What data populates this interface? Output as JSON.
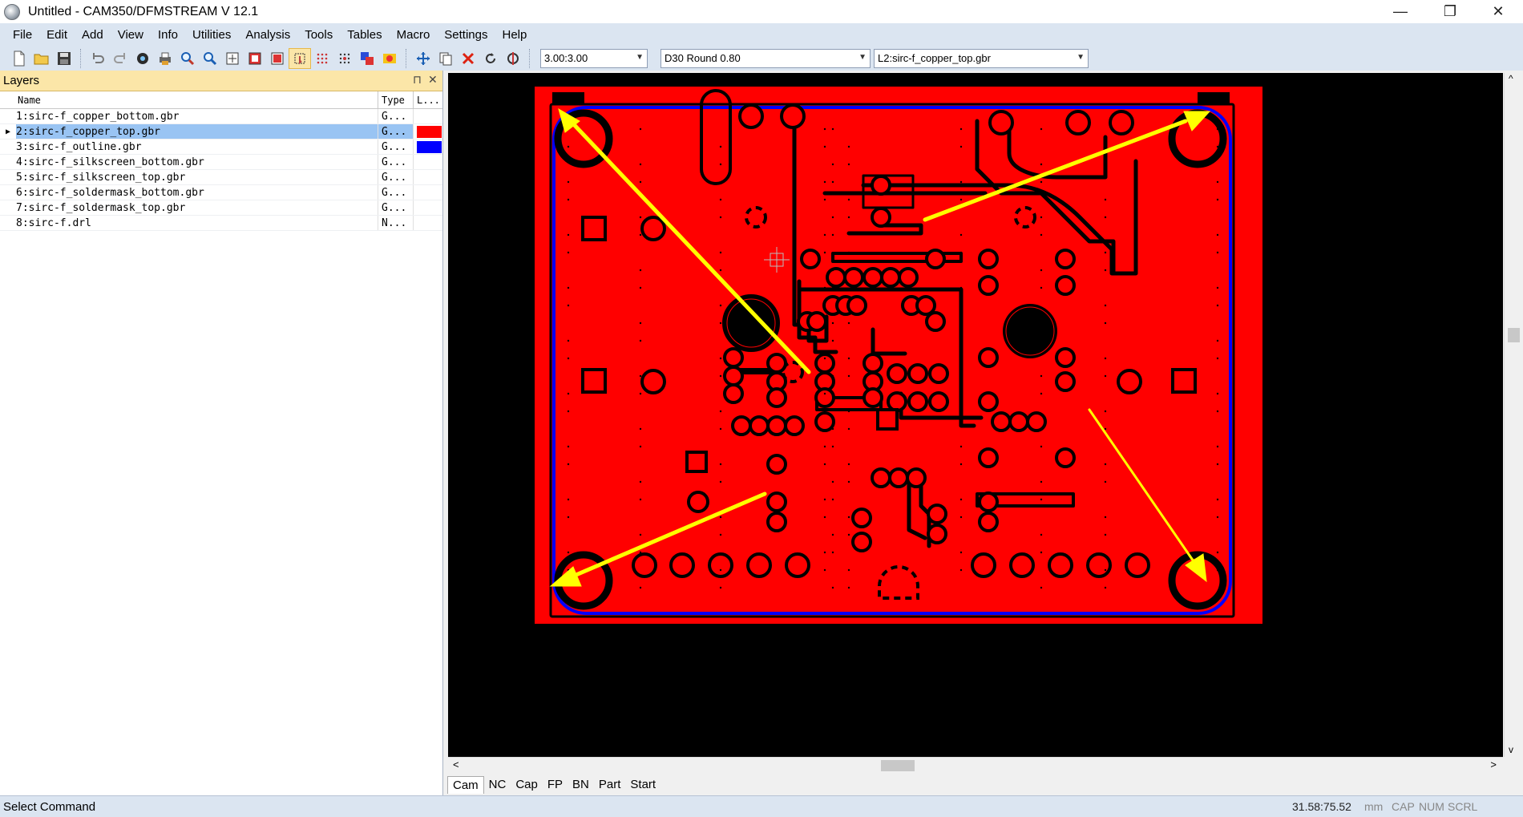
{
  "window": {
    "title": "Untitled - CAM350/DFMSTREAM V 12.1",
    "minimize": "—",
    "restore": "❐",
    "close": "✕"
  },
  "menu": [
    "File",
    "Edit",
    "Add",
    "View",
    "Info",
    "Utilities",
    "Analysis",
    "Tools",
    "Tables",
    "Macro",
    "Settings",
    "Help"
  ],
  "toolbar": {
    "grid_value": "3.00:3.00",
    "aperture_value": "D30  Round 0.80",
    "layer_value": "L2:sirc-f_copper_top.gbr"
  },
  "layers_panel": {
    "title": "Layers",
    "pin": "⊓",
    "close": "✕",
    "columns": [
      "Name",
      "Type",
      "L..."
    ],
    "rows": [
      {
        "name": "1:sirc-f_copper_bottom.gbr",
        "type": "G...",
        "color": ""
      },
      {
        "name": "2:sirc-f_copper_top.gbr",
        "type": "G...",
        "color": "#ff0000"
      },
      {
        "name": "3:sirc-f_outline.gbr",
        "type": "G...",
        "color": "#0000ff"
      },
      {
        "name": "4:sirc-f_silkscreen_bottom.gbr",
        "type": "G...",
        "color": ""
      },
      {
        "name": "5:sirc-f_silkscreen_top.gbr",
        "type": "G...",
        "color": ""
      },
      {
        "name": "6:sirc-f_soldermask_bottom.gbr",
        "type": "G...",
        "color": ""
      },
      {
        "name": "7:sirc-f_soldermask_top.gbr",
        "type": "G...",
        "color": ""
      },
      {
        "name": "8:sirc-f.drl",
        "type": "N...",
        "color": ""
      }
    ]
  },
  "tabs": [
    "Cam",
    "NC",
    "Cap",
    "FP",
    "BN",
    "Part",
    "Start"
  ],
  "status": {
    "command": "Select Command",
    "coords": "31.58:75.52",
    "units": "mm",
    "cap": "CAP",
    "num": "NUM",
    "scrl": "SCRL"
  },
  "colors": {
    "copper": "#ff0000",
    "outline": "#0000ff",
    "annotation": "#ffff00",
    "canvas_bg": "#000000"
  }
}
